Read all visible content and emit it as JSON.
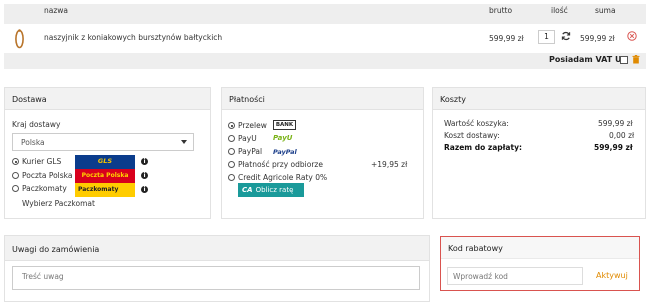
{
  "cart": {
    "headers": {
      "name": "nazwa",
      "gross": "brutto",
      "qty": "ilość",
      "sum": "suma"
    },
    "items": [
      {
        "name": "naszyjnik z koniakowych bursztynów bałtyckich",
        "price": "599,99 zł",
        "quantity": "1",
        "sum": "599,99 zł"
      }
    ],
    "vat_label": "Posiadam VAT UE"
  },
  "shipping": {
    "title": "Dostawa",
    "country_label": "Kraj dostawy",
    "country_value": "Polska",
    "options": [
      {
        "label": "Kurier GLS",
        "logo": "GLS",
        "selected": true
      },
      {
        "label": "Poczta Polska",
        "logo": "Poczta Polska",
        "selected": false
      },
      {
        "label": "Paczkomaty",
        "logo": "Paczkomaty",
        "selected": false
      }
    ],
    "locker_link": "Wybierz Paczkomat"
  },
  "payment": {
    "title": "Płatności",
    "options": [
      {
        "label": "Przelew",
        "logo": "BANK",
        "extra": "",
        "selected": true
      },
      {
        "label": "PayU",
        "logo": "PayU",
        "extra": "",
        "selected": false
      },
      {
        "label": "PayPal",
        "logo": "PayPal",
        "extra": "",
        "selected": false
      },
      {
        "label": "Płatność przy odbiorze",
        "logo": "",
        "extra": "+19,95 zł",
        "selected": false
      },
      {
        "label": "Credit Agricole Raty 0%",
        "logo": "",
        "extra": "",
        "selected": false
      }
    ],
    "installment_button": "Oblicz ratę"
  },
  "costs": {
    "title": "Koszty",
    "cart_value_label": "Wartość koszyka:",
    "cart_value": "599,99 zł",
    "shipping_cost_label": "Koszt dostawy:",
    "shipping_cost": "0,00 zł",
    "total_label": "Razem do zapłaty:",
    "total": "599,99 zł"
  },
  "notes": {
    "title": "Uwagi do zamówienia",
    "placeholder": "Treść uwag"
  },
  "coupon": {
    "title": "Kod rabatowy",
    "placeholder": "Wprowadź kod",
    "apply": "Aktywuj"
  },
  "colors": {
    "accent_orange": "#e08a00",
    "highlight_red": "#d9534f",
    "teal_button": "#1a9a9a",
    "gls_blue": "#0b3c8c",
    "gls_yellow": "#f6c500",
    "poczta_red": "#d8001c",
    "paczkomaty_yellow": "#ffcc00"
  }
}
